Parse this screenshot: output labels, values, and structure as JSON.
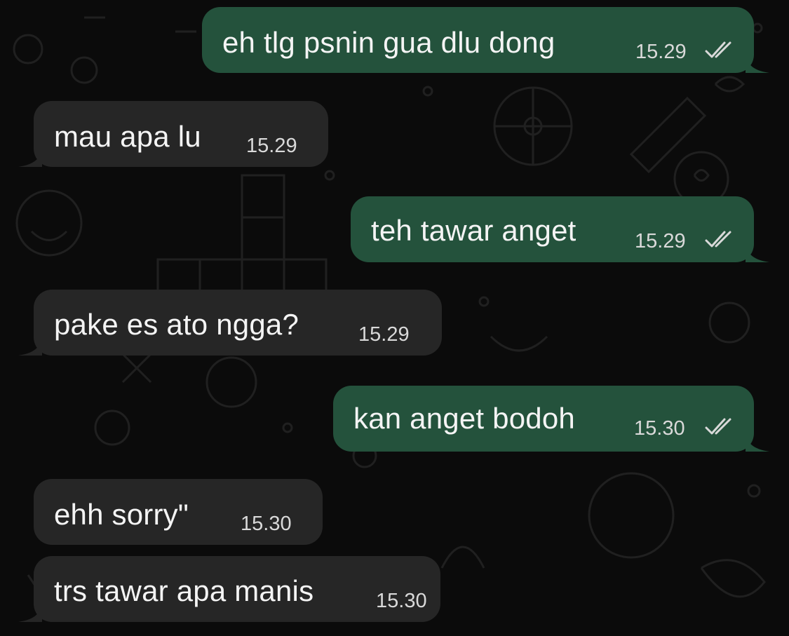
{
  "chat": {
    "colors": {
      "background": "#0b0b0b",
      "outgoing_bubble": "#24523c",
      "incoming_bubble": "#262626",
      "text": "#f4f4f4",
      "time": "#d9d9d9"
    },
    "messages": [
      {
        "direction": "out",
        "text": "eh tlg psnin gua dlu dong",
        "time": "15.29",
        "status": "read-double-check-icon"
      },
      {
        "direction": "in",
        "text": "mau apa lu",
        "time": "15.29"
      },
      {
        "direction": "out",
        "text": "teh tawar anget",
        "time": "15.29",
        "status": "read-double-check-icon"
      },
      {
        "direction": "in",
        "text": "pake es ato ngga?",
        "time": "15.29"
      },
      {
        "direction": "out",
        "text": "kan anget bodoh",
        "time": "15.30",
        "status": "read-double-check-icon"
      },
      {
        "direction": "in",
        "text": "ehh sorry\"",
        "time": "15.30"
      },
      {
        "direction": "in",
        "text": "trs tawar apa manis",
        "time": "15.30"
      }
    ]
  }
}
